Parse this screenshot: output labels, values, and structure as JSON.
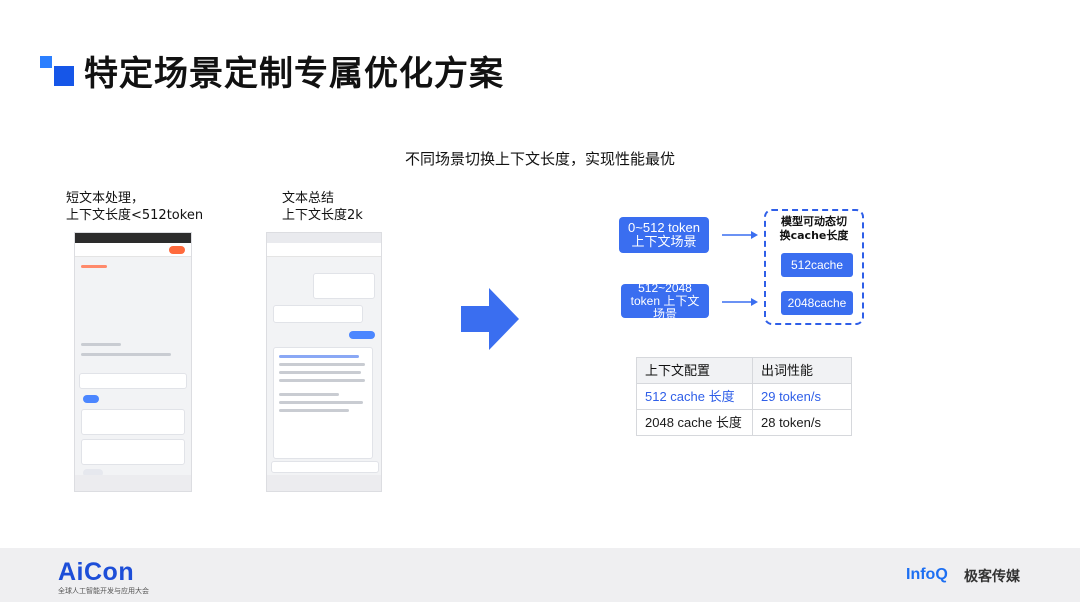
{
  "slide": {
    "title": "特定场景定制专属优化方案",
    "subtitle": "不同场景切换上下文长度，实现性能最优",
    "colors": {
      "accent": "#3a6ef0",
      "dark_accent": "#1656e8",
      "highlight_text": "#2f5fe8"
    }
  },
  "left_case": {
    "line1": "短文本处理，",
    "line2": "上下文长度<512token"
  },
  "right_case": {
    "line1": "文本总结",
    "line2": "上下文长度2k"
  },
  "flow": {
    "scene_1": {
      "line1": "0~512 token",
      "line2": "上下文场景"
    },
    "scene_2": {
      "line1": "512~2048",
      "line2": "token 上下文",
      "line3": "场景"
    },
    "dynamic_box": {
      "line1": "模型可动态切",
      "line2": "换cache长度"
    },
    "cache_1": "512cache",
    "cache_2": "2048cache"
  },
  "table": {
    "headers": [
      "上下文配置",
      "出词性能"
    ],
    "rows": [
      [
        "512 cache 长度",
        "29 token/s"
      ],
      [
        "2048 cache 长度",
        "28 token/s"
      ]
    ]
  },
  "footer": {
    "aicon": "AiCon",
    "aicon_sub": "全球人工智能开发与应用大会",
    "infoq": "InfoQ",
    "infoq_cn": "极客传媒"
  }
}
